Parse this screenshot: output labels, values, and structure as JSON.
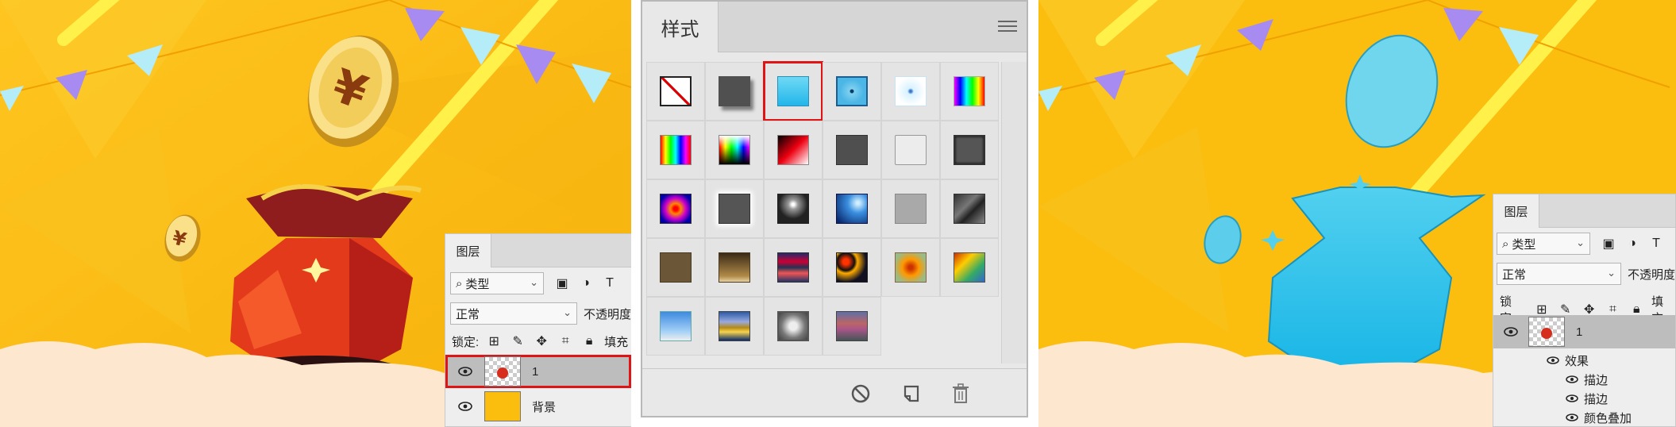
{
  "left_layers": {
    "tab": "图层",
    "filter_label": "类型",
    "blend_mode": "正常",
    "opacity_label": "不透明度",
    "lock_label": "锁定:",
    "fill_label": "填充",
    "layers": [
      {
        "name": "1",
        "selected": true
      },
      {
        "name": "背景",
        "selected": false
      }
    ]
  },
  "styles_panel": {
    "title": "样式",
    "selected_index": 2,
    "swatches": [
      "none",
      "shadow",
      "cyan-gradient",
      "blue-frame",
      "light-glow",
      "rainbow-v",
      "rainbow-h",
      "hue-bar",
      "red-black",
      "dark-gray",
      "white-outline",
      "gray-shadow",
      "radial-rainbow",
      "gray-glow",
      "chrome-sphere",
      "blue-glass",
      "light-gray",
      "rock",
      "brown",
      "brown-gradient",
      "stripe-blue-red",
      "abstract-red",
      "orange-blur",
      "rainbow-blend",
      "sky-blue",
      "sunset-stripe",
      "stone-frame",
      "purple-stripe"
    ],
    "footer_icons": [
      "clear-style-icon",
      "new-style-icon",
      "delete-icon"
    ]
  },
  "right_layers": {
    "tab": "图层",
    "filter_label": "类型",
    "blend_mode": "正常",
    "opacity_label": "不透明度",
    "lock_label": "锁定:",
    "fill_label": "填充",
    "layer_name": "1",
    "effects_label": "效果",
    "effects": [
      "描边",
      "描边",
      "颜色叠加"
    ]
  },
  "colors": {
    "scene_yellow": "#fbbd0e",
    "selection_red": "#e01414",
    "bag_cyan": "#3ec9ef",
    "banner_purple": "#a78bf0",
    "banner_lightblue": "#b4ecf7"
  }
}
